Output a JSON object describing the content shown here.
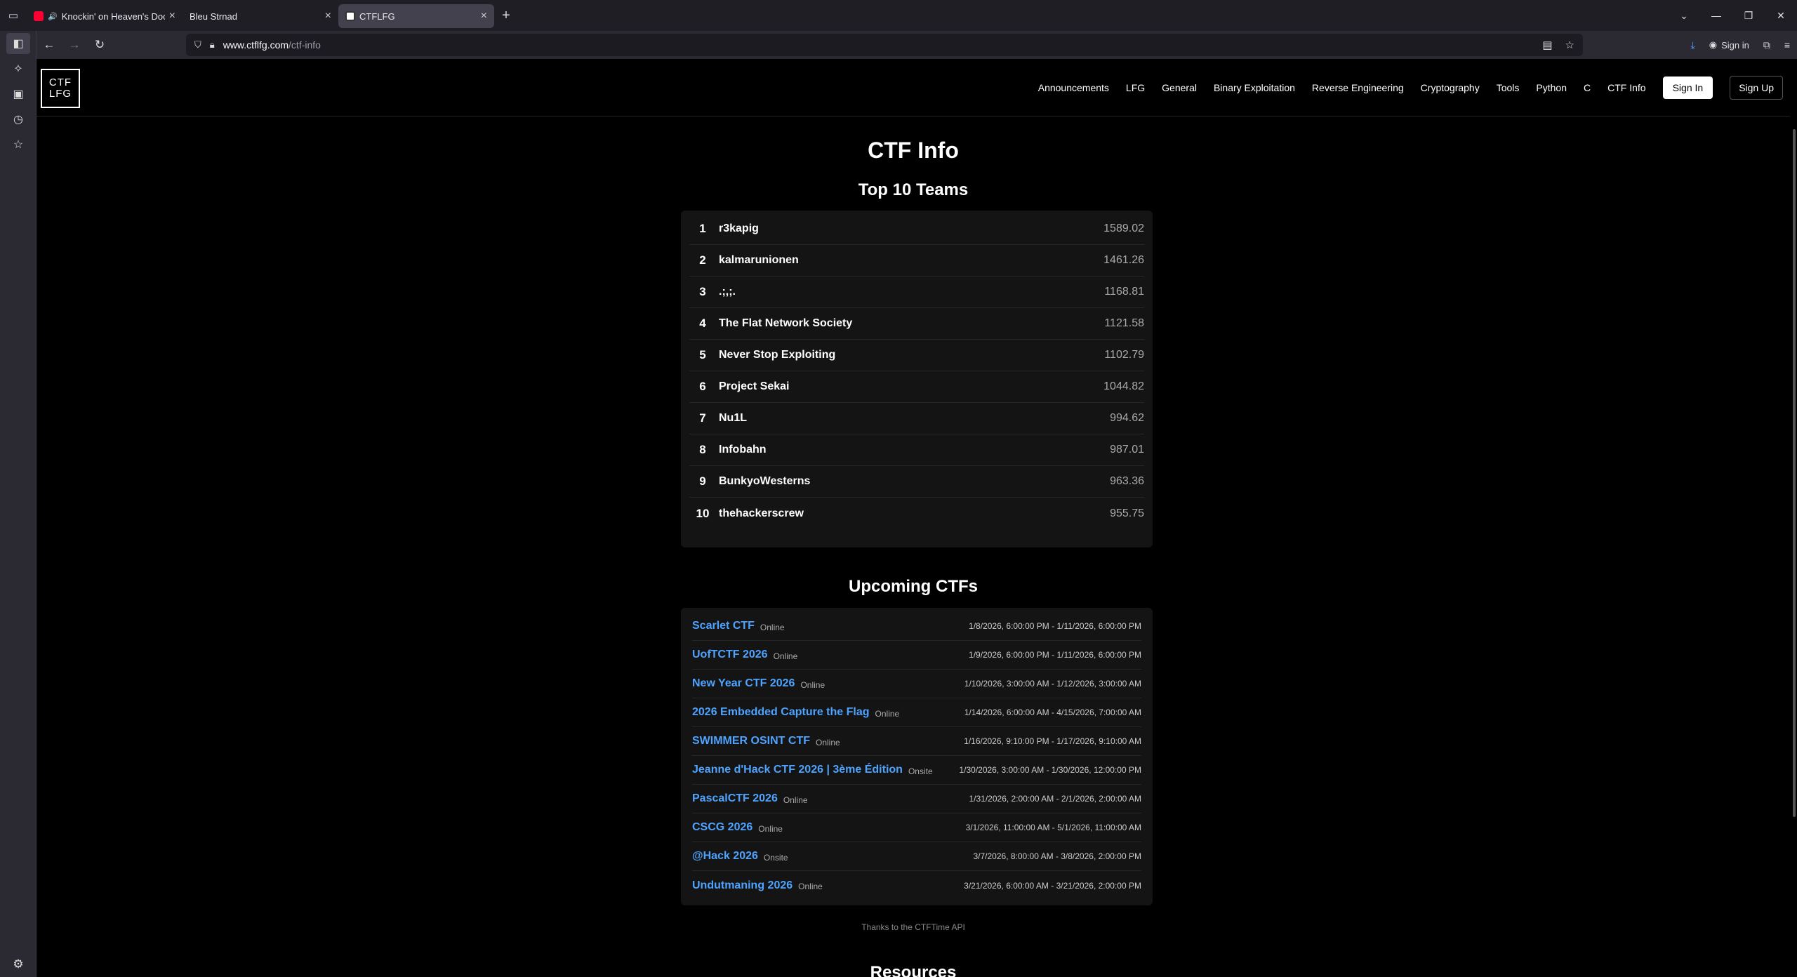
{
  "browser": {
    "tabs": [
      {
        "title": "Knockin' on Heaven's Door",
        "favicon": "youtube-icon",
        "audio": true,
        "active": false
      },
      {
        "title": "Bleu Strnad",
        "favicon": "none",
        "audio": false,
        "active": false
      },
      {
        "title": "CTFLFG",
        "favicon": "ctflfg-icon",
        "audio": false,
        "active": true
      }
    ],
    "url_host": "www.ctflfg.com",
    "url_path": "/ctf-info",
    "signin_label": "Sign in"
  },
  "site": {
    "logo_line1": "CTF",
    "logo_line2": "LFG",
    "nav": [
      "Announcements",
      "LFG",
      "General",
      "Binary Exploitation",
      "Reverse Engineering",
      "Cryptography",
      "Tools",
      "Python",
      "C",
      "CTF Info"
    ],
    "signin": "Sign In",
    "signup": "Sign Up"
  },
  "page": {
    "title": "CTF Info",
    "teams_heading": "Top 10 Teams",
    "teams": [
      {
        "rank": "1",
        "name": "r3kapig",
        "score": "1589.02"
      },
      {
        "rank": "2",
        "name": "kalmarunionen",
        "score": "1461.26"
      },
      {
        "rank": "3",
        "name": ".;,;.",
        "score": "1168.81"
      },
      {
        "rank": "4",
        "name": "The Flat Network Society",
        "score": "1121.58"
      },
      {
        "rank": "5",
        "name": "Never Stop Exploiting",
        "score": "1102.79"
      },
      {
        "rank": "6",
        "name": "Project Sekai",
        "score": "1044.82"
      },
      {
        "rank": "7",
        "name": "Nu1L",
        "score": "994.62"
      },
      {
        "rank": "8",
        "name": "Infobahn",
        "score": "987.01"
      },
      {
        "rank": "9",
        "name": "BunkyoWesterns",
        "score": "963.36"
      },
      {
        "rank": "10",
        "name": "thehackerscrew",
        "score": "955.75"
      }
    ],
    "upcoming_heading": "Upcoming CTFs",
    "ctfs": [
      {
        "name": "Scarlet CTF",
        "location": "Online",
        "dates": "1/8/2026, 6:00:00 PM - 1/11/2026, 6:00:00 PM"
      },
      {
        "name": "UofTCTF 2026",
        "location": "Online",
        "dates": "1/9/2026, 6:00:00 PM - 1/11/2026, 6:00:00 PM"
      },
      {
        "name": "New Year CTF 2026",
        "location": "Online",
        "dates": "1/10/2026, 3:00:00 AM - 1/12/2026, 3:00:00 AM"
      },
      {
        "name": "2026 Embedded Capture the Flag",
        "location": "Online",
        "dates": "1/14/2026, 6:00:00 AM - 4/15/2026, 7:00:00 AM"
      },
      {
        "name": "SWIMMER OSINT CTF",
        "location": "Online",
        "dates": "1/16/2026, 9:10:00 PM - 1/17/2026, 9:10:00 AM"
      },
      {
        "name": "Jeanne d'Hack CTF 2026 | 3ème Édition",
        "location": "Onsite",
        "dates": "1/30/2026, 3:00:00 AM - 1/30/2026, 12:00:00 PM"
      },
      {
        "name": "PascalCTF 2026",
        "location": "Online",
        "dates": "1/31/2026, 2:00:00 AM - 2/1/2026, 2:00:00 AM"
      },
      {
        "name": "CSCG 2026",
        "location": "Online",
        "dates": "3/1/2026, 11:00:00 AM - 5/1/2026, 11:00:00 AM"
      },
      {
        "name": "@Hack 2026",
        "location": "Onsite",
        "dates": "3/7/2026, 8:00:00 AM - 3/8/2026, 2:00:00 PM"
      },
      {
        "name": "Undutmaning 2026",
        "location": "Online",
        "dates": "3/21/2026, 6:00:00 AM - 3/21/2026, 2:00:00 PM"
      }
    ],
    "thanks": "Thanks to the CTFTime API",
    "resources_heading": "Resources"
  }
}
